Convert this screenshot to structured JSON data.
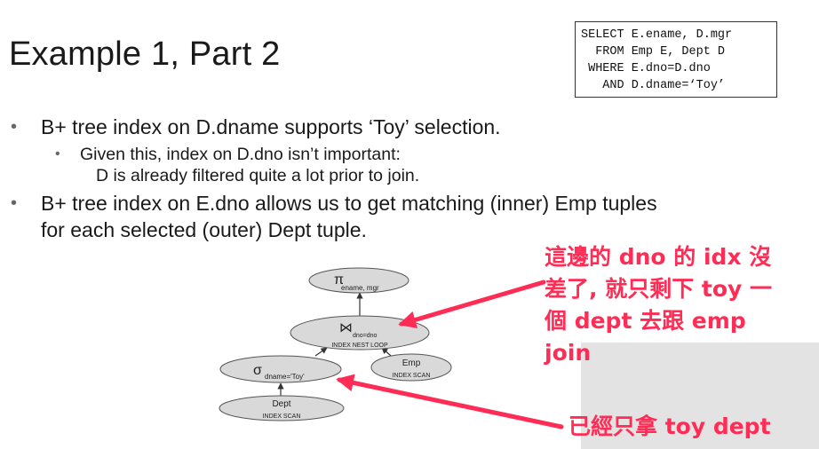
{
  "slide": {
    "title": "Example 1, Part 2",
    "sql": [
      "SELECT E.ename, D.mgr",
      "  FROM Emp E, Dept D",
      " WHERE E.dno=D.dno",
      "   AND D.dname=‘Toy’"
    ],
    "bullet1": "B+ tree index on D.dname supports ‘Toy’ selection.",
    "sub_bullet": "Given this, index on D.dno isn’t important:",
    "sub_bullet_cont": "D is already filtered quite a lot prior to join.",
    "bullet2_line1": "B+ tree index on E.dno allows us to get matching (inner) Emp tuples",
    "bullet2_line2": "for each selected (outer) Dept tuple.",
    "bullet_char": "•"
  },
  "plan": {
    "project_symbol": "π",
    "project_sub": "ename, mgr",
    "join_symbol": "⋈",
    "join_sub": "dno=dno",
    "join_method": "INDEX NEST LOOP",
    "select_symbol": "σ",
    "select_sub": "dname='Toy'",
    "emp_label": "Emp",
    "emp_method": "INDEX SCAN",
    "dept_label": "Dept",
    "dept_method": "INDEX SCAN"
  },
  "annotations": {
    "note1_lines": [
      "這邊的 dno 的 idx 沒",
      "差了, 就只剩下 toy 一",
      "個 dept 去跟 emp",
      "join"
    ],
    "note2": "已經只拿 toy dept",
    "color": "#ff2d55"
  },
  "colors": {
    "node_fill": "#d9d9d9",
    "node_stroke": "#555555",
    "gray_panel": "#e3e3e3"
  }
}
